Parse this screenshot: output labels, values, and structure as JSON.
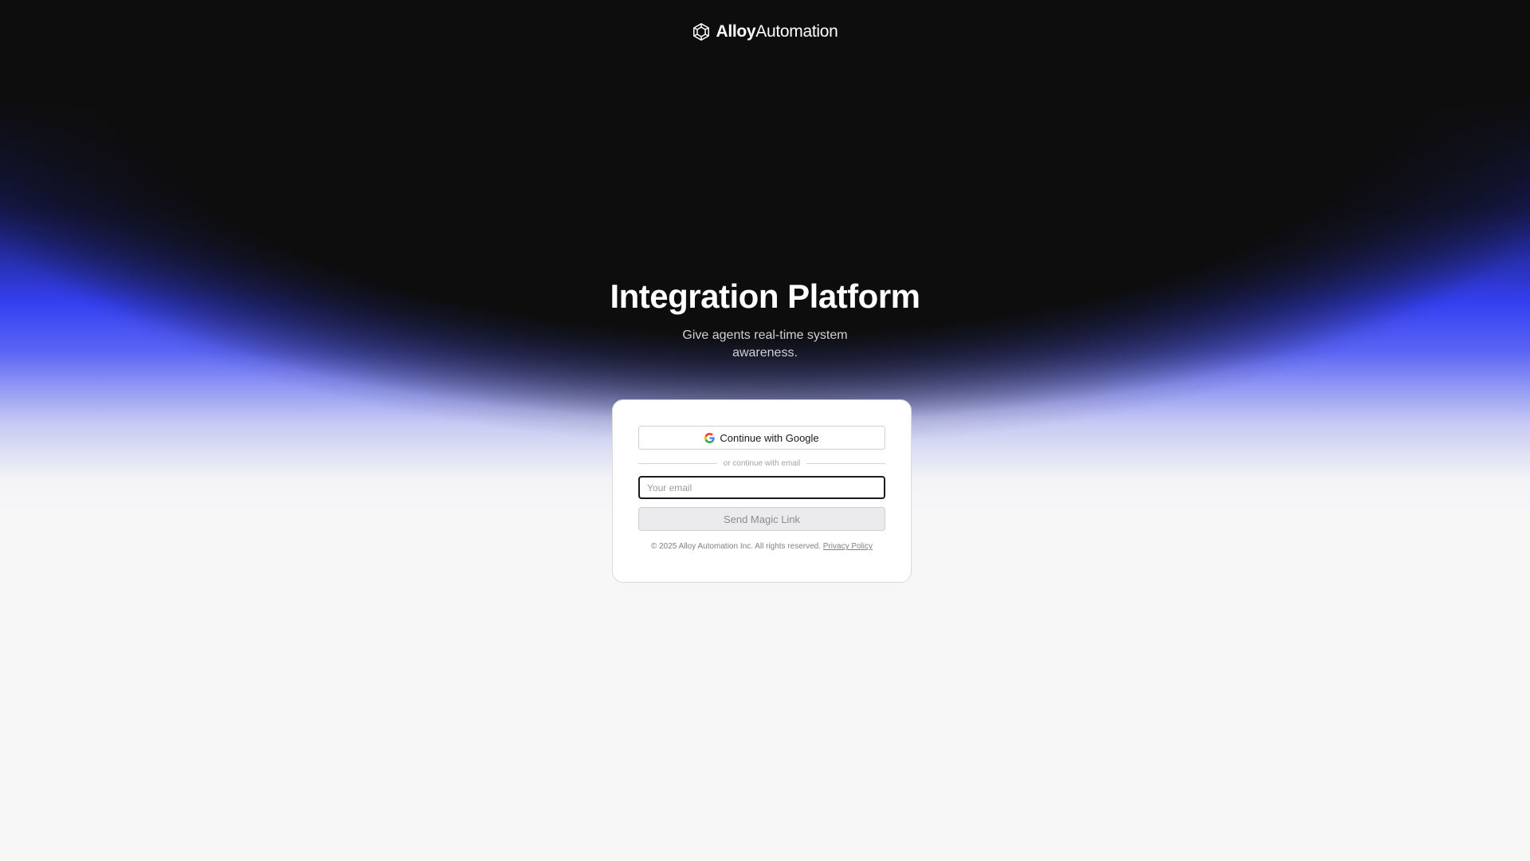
{
  "header": {
    "brand_bold": "Alloy",
    "brand_light": "Automation",
    "logo_icon": "alloy-logo-icon"
  },
  "hero": {
    "title": "Integration Platform",
    "subtitle": "Give agents real-time system awareness."
  },
  "login_card": {
    "google_button_label": "Continue with Google",
    "google_icon": "google-icon",
    "divider_text": "or continue with email",
    "email_placeholder": "Your email",
    "email_value": "",
    "magic_link_label": "Send Magic Link",
    "copyright": "© 2025 Alloy Automation Inc. All rights reserved.",
    "privacy_link": "Privacy Policy"
  },
  "colors": {
    "background_dark": "#0d0d0d",
    "accent_blue": "#3440f2",
    "background_light": "#f7f7f8"
  }
}
